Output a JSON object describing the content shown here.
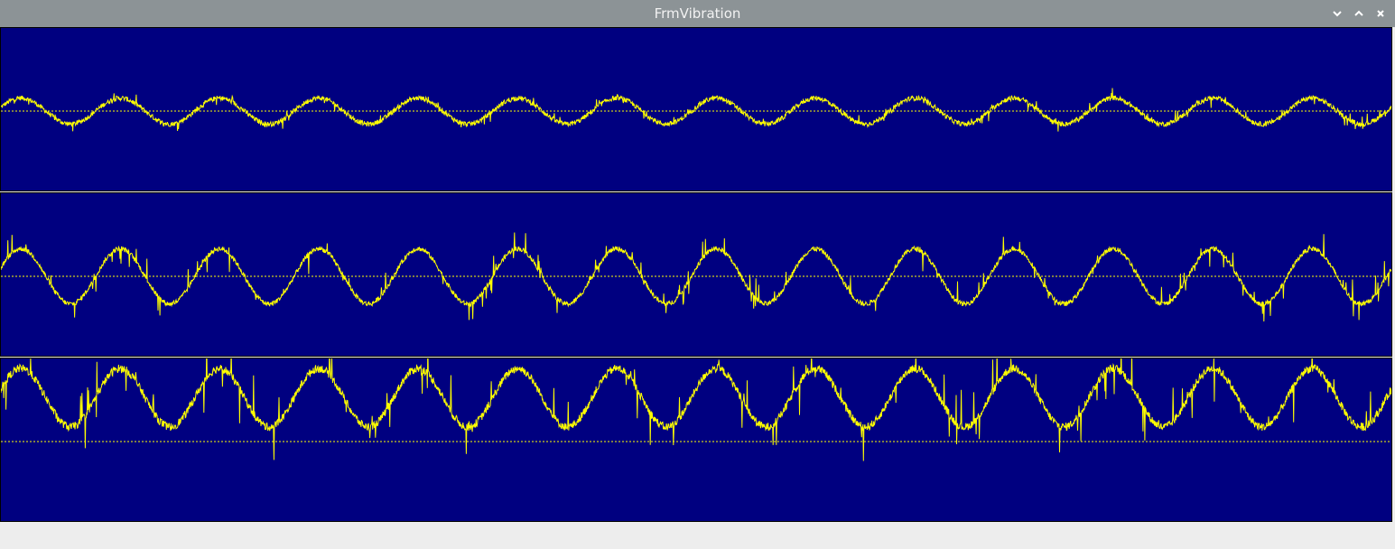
{
  "window": {
    "title": "FrmVibration",
    "controls": [
      "minimize",
      "maximize",
      "close"
    ]
  },
  "colors": {
    "titlebar": "#8c9396",
    "panel_background": "#000080",
    "trace": "#ffff00",
    "form_background": "#ededed"
  },
  "channels": [
    {
      "id": "ch1",
      "cycles": 14,
      "amplitude": 0.08,
      "offset": 0.0,
      "noise": 0.03,
      "spikes": 0.05
    },
    {
      "id": "ch2",
      "cycles": 14,
      "amplitude": 0.17,
      "offset": 0.0,
      "noise": 0.03,
      "spikes": 0.12
    },
    {
      "id": "ch3",
      "cycles": 14,
      "amplitude": 0.18,
      "offset": 0.27,
      "noise": 0.05,
      "spikes": 0.22
    }
  ]
}
